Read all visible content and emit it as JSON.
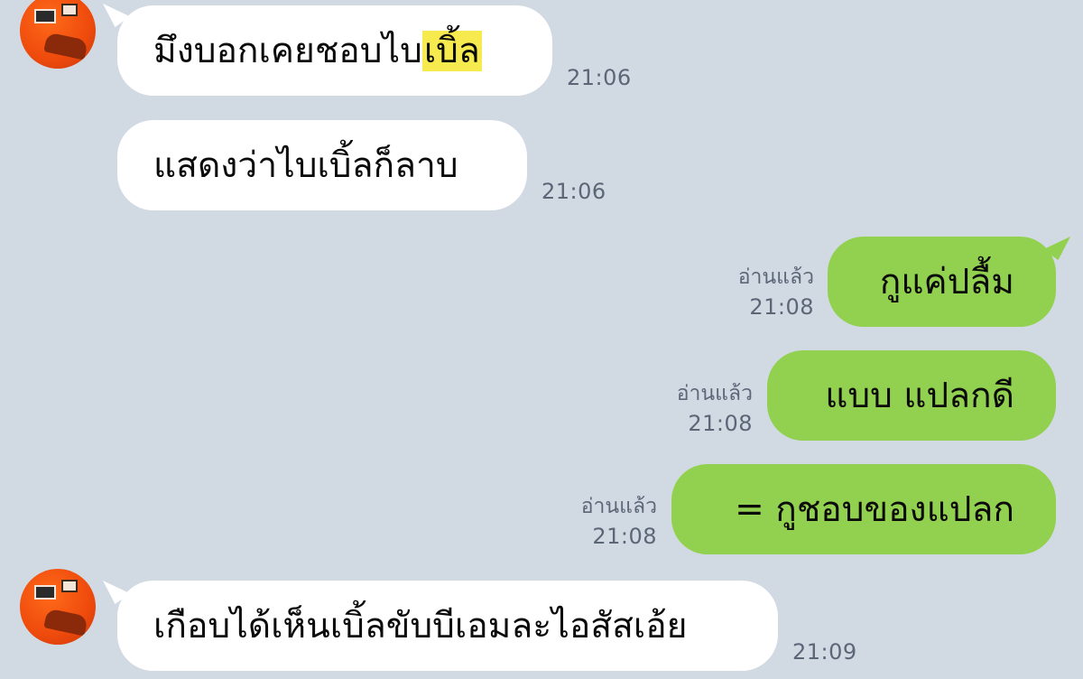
{
  "messages": [
    {
      "side": "in",
      "text_before": "มึงบอกเคยชอบไบ",
      "highlight": "เบิ้ล",
      "time": "21:06"
    },
    {
      "side": "in",
      "text": "แสดงว่าไบเบิ้ลก็ลาบ",
      "time": "21:06"
    },
    {
      "side": "out",
      "text": "กูแค่ปลื้ม",
      "status": "อ่านแล้ว",
      "time": "21:08"
    },
    {
      "side": "out",
      "text": "แบบ แปลกดี",
      "status": "อ่านแล้ว",
      "time": "21:08"
    },
    {
      "side": "out",
      "text": "= กูชอบของแปลก",
      "status": "อ่านแล้ว",
      "time": "21:08"
    },
    {
      "side": "in",
      "text": "เกือบได้เห็นเบิ้ลขับบีเอมละไอสัสเอ้ย",
      "time": "21:09"
    }
  ],
  "colors": {
    "background": "#d1d9e3",
    "incoming_bubble": "#ffffff",
    "outgoing_bubble": "#92d050",
    "highlight": "#f6ea4f",
    "timestamp": "#5b6677"
  },
  "icons": {
    "contact_avatar": "orange-room-photo-avatar"
  }
}
